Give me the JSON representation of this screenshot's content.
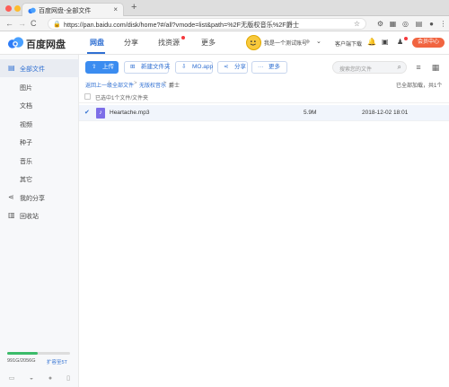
{
  "browser": {
    "tab_title": "百度网盘-全部文件",
    "tab_close": "×",
    "new_tab": "+",
    "url": "https://pan.baidu.com/disk/home?#/all?vmode=list&path=%2F无版权音乐%2F爵士",
    "nav": {
      "back": "←",
      "forward": "→",
      "reload": "C",
      "home": "⌂"
    },
    "star": "☆"
  },
  "app": {
    "logo_text": "百度网盘",
    "nav": [
      {
        "label": "网盘",
        "active": true
      },
      {
        "label": "分享"
      },
      {
        "label": "找资源"
      },
      {
        "label": "更多"
      }
    ],
    "username": "我是一个测试账号",
    "client_download": "客户端下载",
    "vip_button": "会员中心"
  },
  "sidebar": {
    "items": [
      {
        "label": "全部文件"
      },
      {
        "label": "图片"
      },
      {
        "label": "文档"
      },
      {
        "label": "视频"
      },
      {
        "label": "种子"
      },
      {
        "label": "音乐"
      },
      {
        "label": "其它"
      },
      {
        "label": "我的分享"
      },
      {
        "label": "回收站"
      }
    ],
    "quota_text": "991G/2056G",
    "quota_fraction": 0.48,
    "expand_label": "扩容至5T"
  },
  "toolbar": {
    "upload": "上传",
    "new_folder": "新建文件夹",
    "mo_app": "MO.app",
    "share": "分享",
    "more": "更多",
    "search_placeholder": "搜索您的文件"
  },
  "breadcrumb": {
    "back": "返回上一级",
    "items": [
      "全部文件",
      "无版权音乐",
      "爵士"
    ],
    "sep": ">"
  },
  "status": {
    "loaded": "已全部加载，共1个",
    "selected": "已选中1个文件/文件夹"
  },
  "files": [
    {
      "name": "Heartache.mp3",
      "size": "5.9M",
      "date": "2018-12-02 18:01"
    }
  ],
  "colors": {
    "accent": "#2f6fd2",
    "vip": "#f16440",
    "quota": "#3bbb6a"
  }
}
